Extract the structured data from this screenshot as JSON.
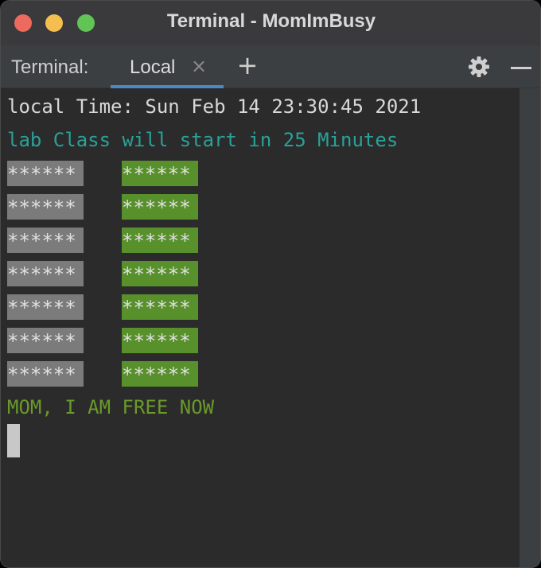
{
  "window": {
    "title": "Terminal - MomImBusy"
  },
  "tabbar": {
    "label": "Terminal:",
    "tabs": [
      {
        "label": "Local",
        "active": true
      }
    ],
    "close_glyph": "×",
    "add_glyph": "+"
  },
  "terminal": {
    "lines": {
      "time": "local Time: Sun Feb 14 23:30:45 2021",
      "lab": "lab Class will start in 25 Minutes",
      "free": "MOM, I AM FREE NOW"
    },
    "rows": [
      {
        "left": "******",
        "right": "******"
      },
      {
        "left": "******",
        "right": "******"
      },
      {
        "left": "******",
        "right": "******"
      },
      {
        "left": "******",
        "right": "******"
      },
      {
        "left": "******",
        "right": "******"
      },
      {
        "left": "******",
        "right": "******"
      },
      {
        "left": "******",
        "right": "******"
      }
    ]
  },
  "colors": {
    "lab_text": "#2aa198",
    "free_text": "#6a9a2a",
    "gray_block": "#7b7b7b",
    "green_block": "#58912c",
    "tab_underline": "#4a88c7"
  },
  "icons": {
    "close": "close-icon",
    "add": "plus-icon",
    "settings": "gear-icon",
    "hide": "minimize-icon"
  }
}
